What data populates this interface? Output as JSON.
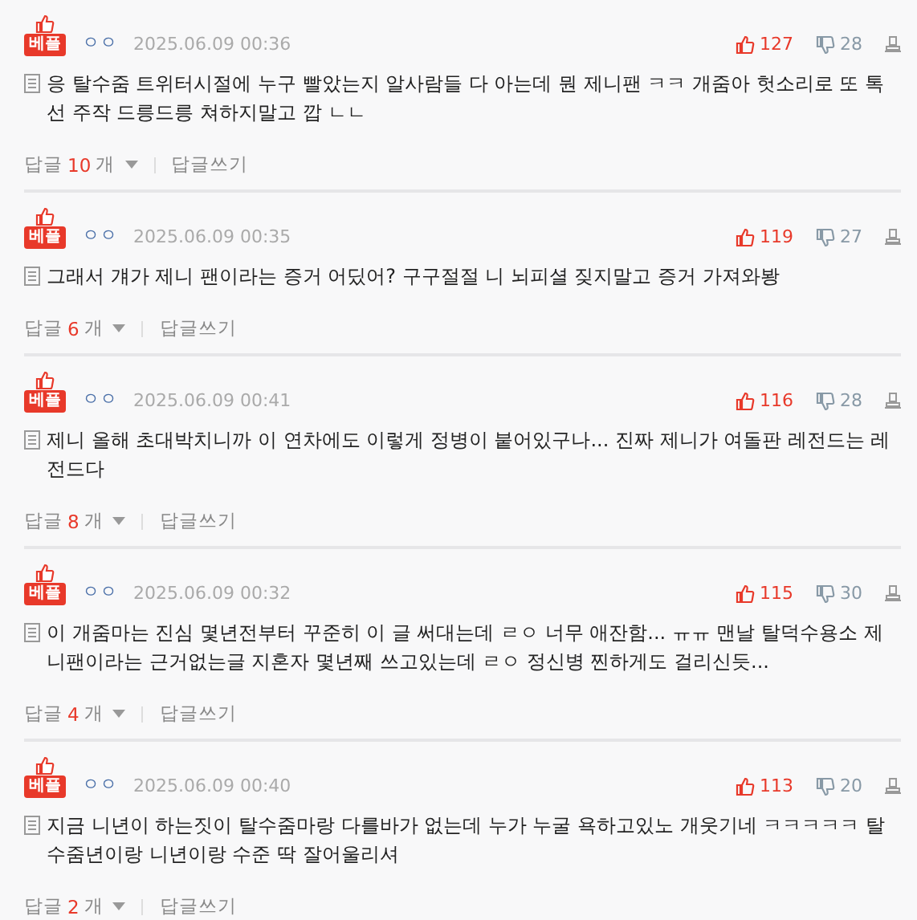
{
  "comments": [
    {
      "badge": "베플",
      "author": "ㅇㅇ",
      "date": "2025.06.09 00:36",
      "likes": "127",
      "dislikes": "28",
      "text": "응 탈수줌 트위터시절에 누구 빨았는지 알사람들 다 아는데 뭔 제니팬 ㅋㅋ 개줌아 헛소리로 또 톡선 주작 드릉드릉 쳐하지말고 깝 ㄴㄴ",
      "reply_label": "답글",
      "reply_count": "10",
      "reply_unit": "개",
      "write_reply": "답글쓰기"
    },
    {
      "badge": "베플",
      "author": "ㅇㅇ",
      "date": "2025.06.09 00:35",
      "likes": "119",
      "dislikes": "27",
      "text": "그래서 걔가 제니 팬이라는 증거 어딨어? 구구절절 니 뇌피셜 짖지말고 증거 가져와봥",
      "reply_label": "답글",
      "reply_count": "6",
      "reply_unit": "개",
      "write_reply": "답글쓰기"
    },
    {
      "badge": "베플",
      "author": "ㅇㅇ",
      "date": "2025.06.09 00:41",
      "likes": "116",
      "dislikes": "28",
      "text": "제니 올해 초대박치니까 이 연차에도 이렇게 정병이 붙어있구나... 진짜 제니가 여돌판 레전드는 레전드다",
      "reply_label": "답글",
      "reply_count": "8",
      "reply_unit": "개",
      "write_reply": "답글쓰기"
    },
    {
      "badge": "베플",
      "author": "ㅇㅇ",
      "date": "2025.06.09 00:32",
      "likes": "115",
      "dislikes": "30",
      "text": "이 개줌마는 진심 몇년전부터 꾸준히 이 글 써대는데 ㄹㅇ 너무 애잔함... ㅠㅠ 맨날 탈덕수용소 제니팬이라는 근거없는글 지혼자 몇년째 쓰고있는데 ㄹㅇ 정신병 찐하게도 걸리신듯...",
      "reply_label": "답글",
      "reply_count": "4",
      "reply_unit": "개",
      "write_reply": "답글쓰기"
    },
    {
      "badge": "베플",
      "author": "ㅇㅇ",
      "date": "2025.06.09 00:40",
      "likes": "113",
      "dislikes": "20",
      "text": "지금 니년이 하는짓이 탈수줌마랑 다를바가 없는데 누가 누굴 욕하고있노 개웃기네 ㅋㅋㅋㅋㅋ 탈수줌년이랑 니년이랑 수준 딱 잘어울리셔",
      "reply_label": "답글",
      "reply_count": "2",
      "reply_unit": "개",
      "write_reply": "답글쓰기"
    }
  ]
}
